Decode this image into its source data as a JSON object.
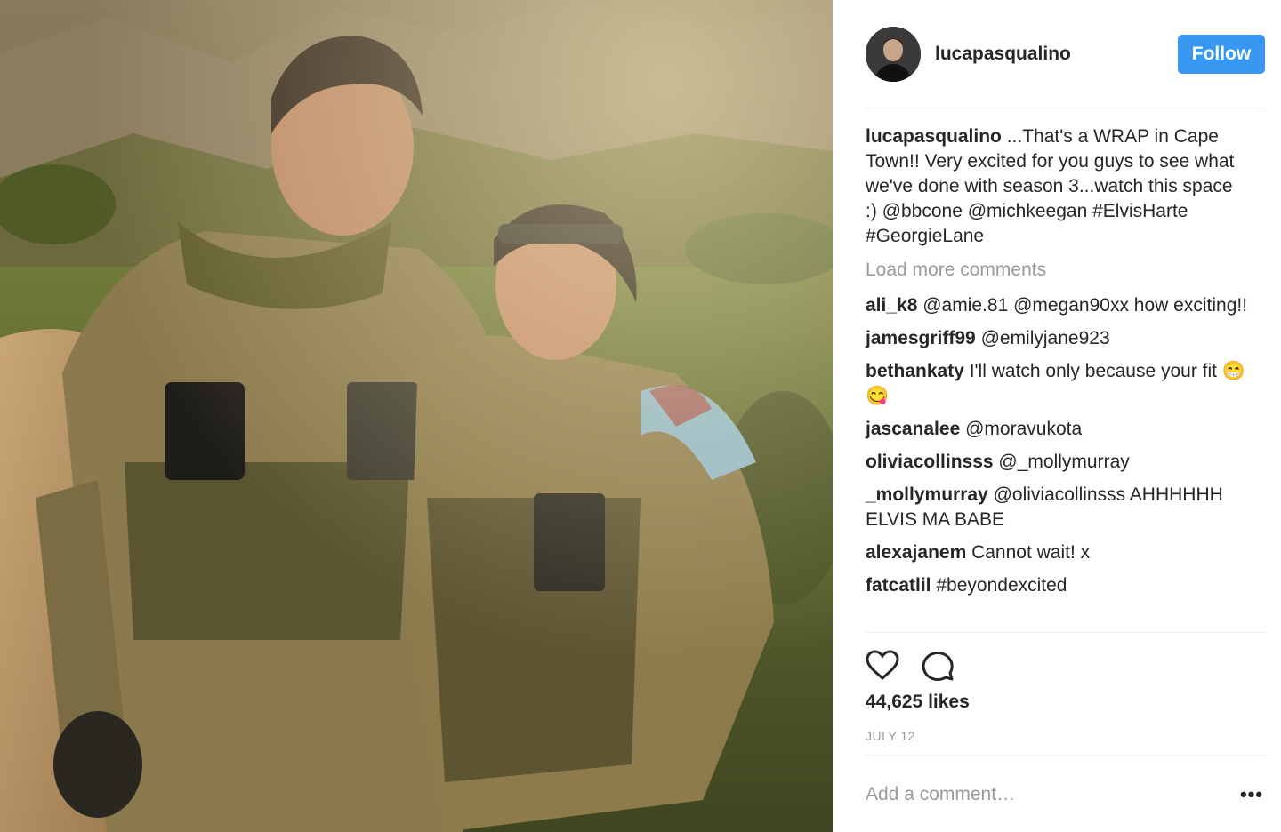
{
  "photo": {
    "alt": ""
  },
  "header": {
    "username": "lucapasqualino",
    "follow_label": "Follow"
  },
  "caption": {
    "user": "lucapasqualino",
    "text": " ...That's a WRAP in Cape Town!! Very excited for you guys to see what we've done with season 3...watch this space :) @bbcone @michkeegan #ElvisHarte #GeorgieLane"
  },
  "load_more": "Load more comments",
  "comments": [
    {
      "user": "ali_k8",
      "text": " @amie.81 @megan90xx how exciting!!"
    },
    {
      "user": "jamesgriff99",
      "text": " @emilyjane923"
    },
    {
      "user": "bethankaty",
      "text": " I'll watch only because your fit 😁😋"
    },
    {
      "user": "jascanalee",
      "text": " @moravukota"
    },
    {
      "user": "oliviacollinsss",
      "text": " @_mollymurray"
    },
    {
      "user": "_mollymurray",
      "text": " @oliviacollinsss AHHHHHH ELVIS MA BABE"
    },
    {
      "user": "alexajanem",
      "text": " Cannot wait! x"
    },
    {
      "user": "fatcatlil",
      "text": " #beyondexcited"
    }
  ],
  "actions": {
    "like_icon": "heart-icon",
    "comment_icon": "comment-bubble-icon"
  },
  "likes": "44,625 likes",
  "date": "JULY 12",
  "add_comment": {
    "placeholder": "Add a comment…",
    "more_icon": "more-options-icon",
    "more_label": "•••"
  },
  "colors": {
    "accent": "#3897f0",
    "text": "#262626",
    "muted": "#999999",
    "divider": "#efefef"
  }
}
